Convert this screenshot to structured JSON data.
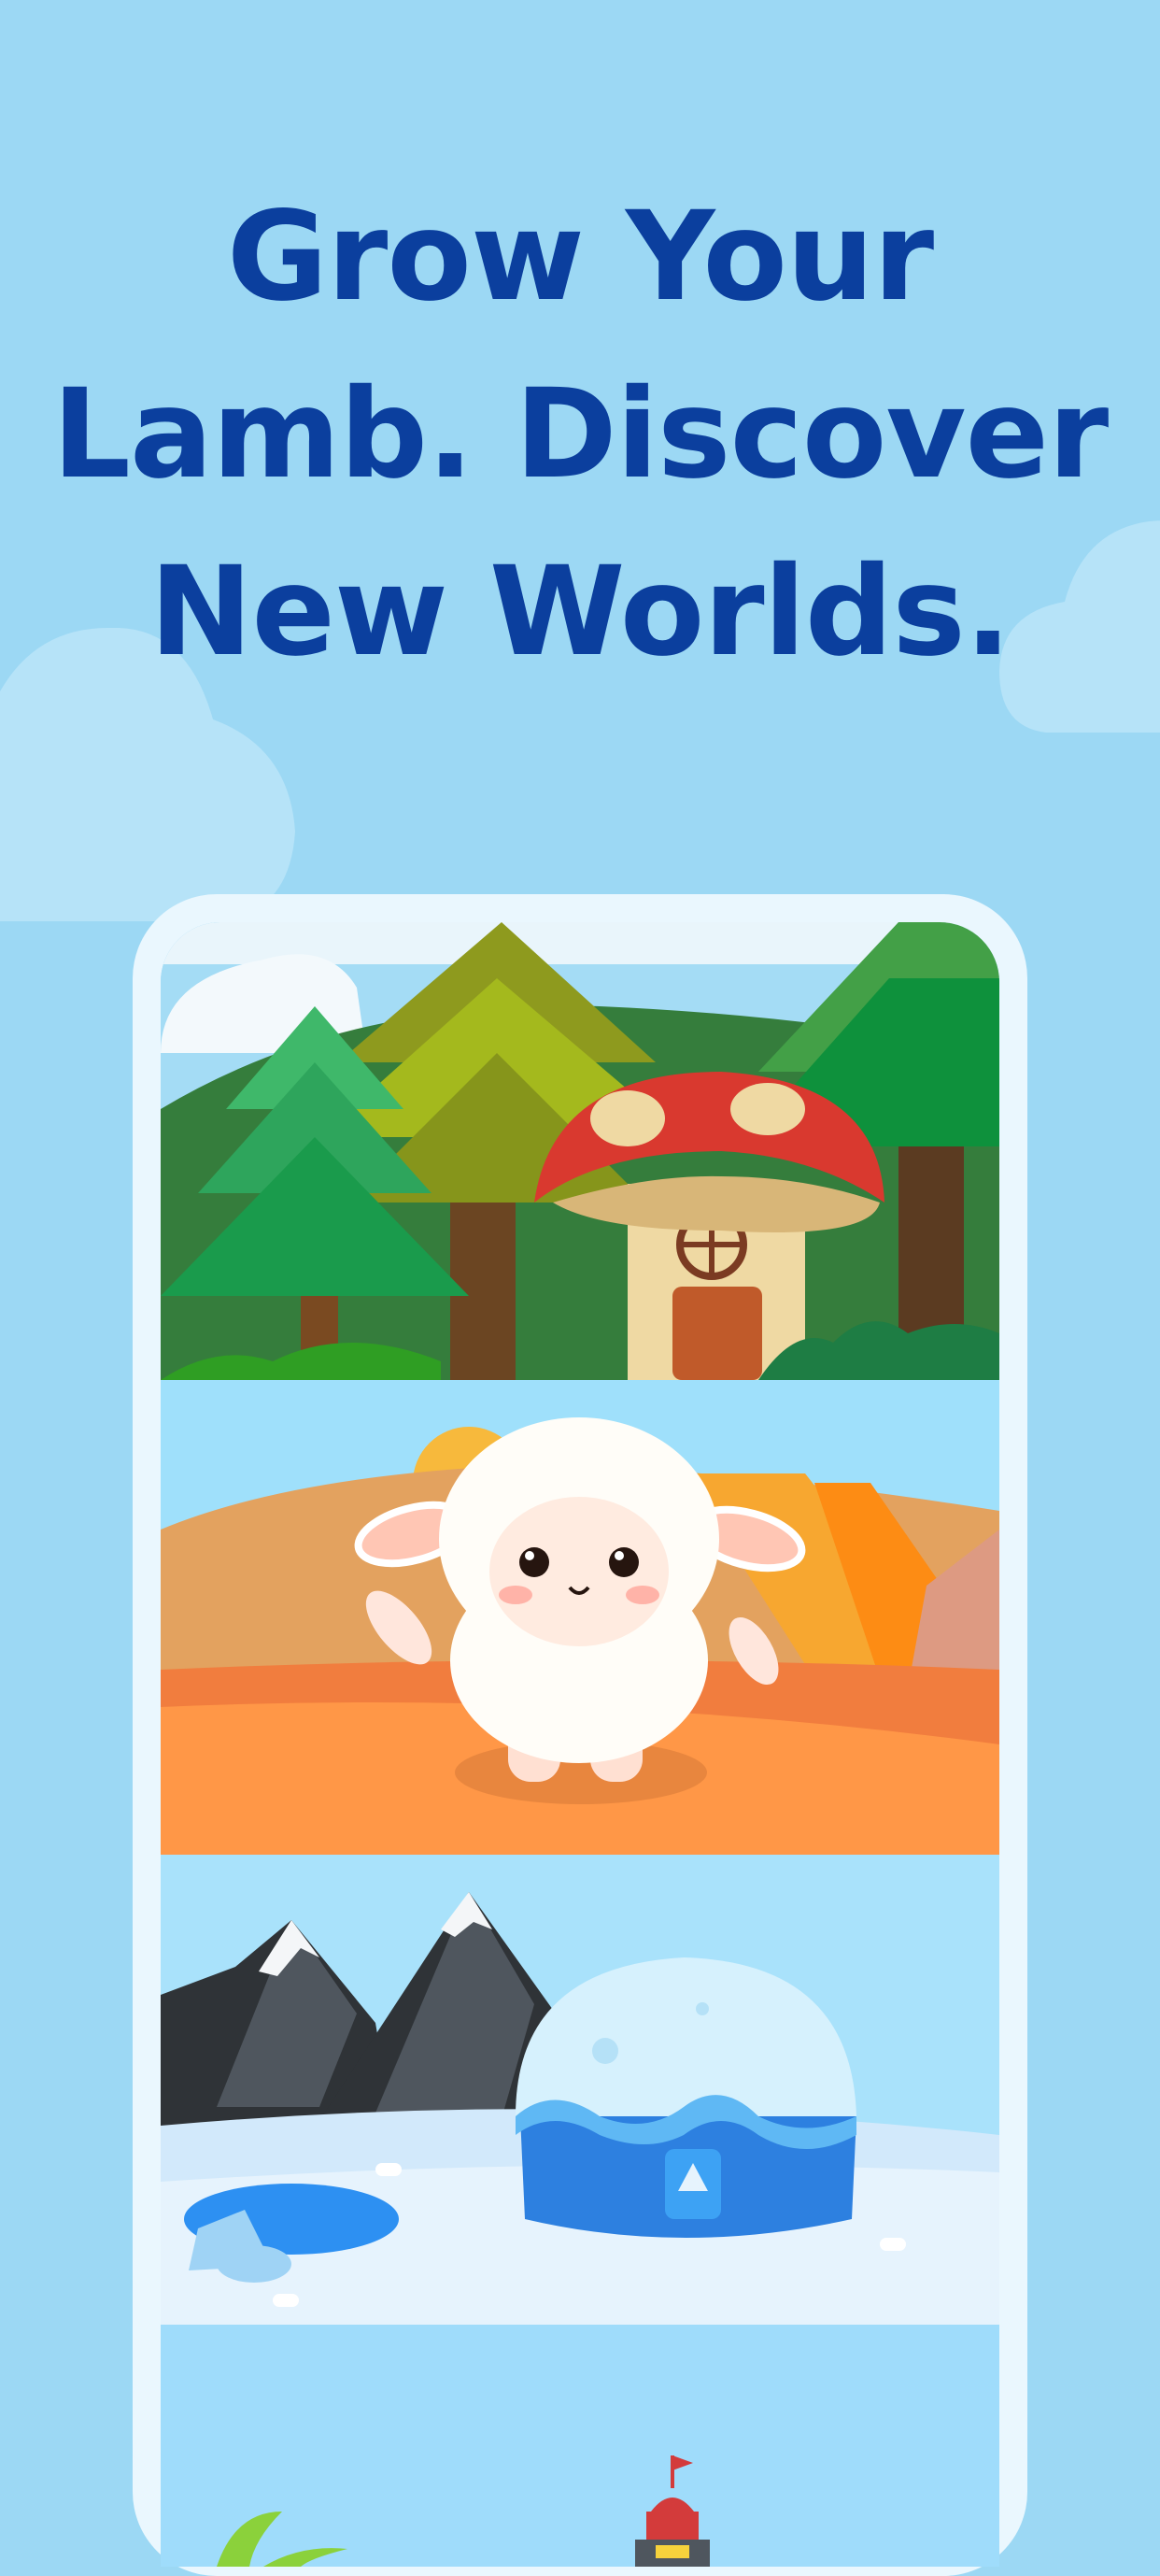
{
  "headline": {
    "line1": "Grow Your",
    "line2": "Lamb. Discover",
    "line3": "New Worlds."
  },
  "colors": {
    "background": "#9cd8f4",
    "headline": "#0b3f9e",
    "phone_frame": "#eaf7fe"
  },
  "worlds": [
    {
      "name": "forest-world",
      "icons": [
        "pine-tree-icon",
        "mushroom-house-icon"
      ]
    },
    {
      "name": "desert-world",
      "icons": [
        "lamb-character-icon",
        "sun-icon"
      ]
    },
    {
      "name": "snow-world",
      "icons": [
        "mountain-icon",
        "igloo-icon",
        "pond-icon"
      ]
    },
    {
      "name": "beach-world",
      "icons": [
        "lighthouse-icon",
        "palm-leaf-icon"
      ]
    }
  ]
}
